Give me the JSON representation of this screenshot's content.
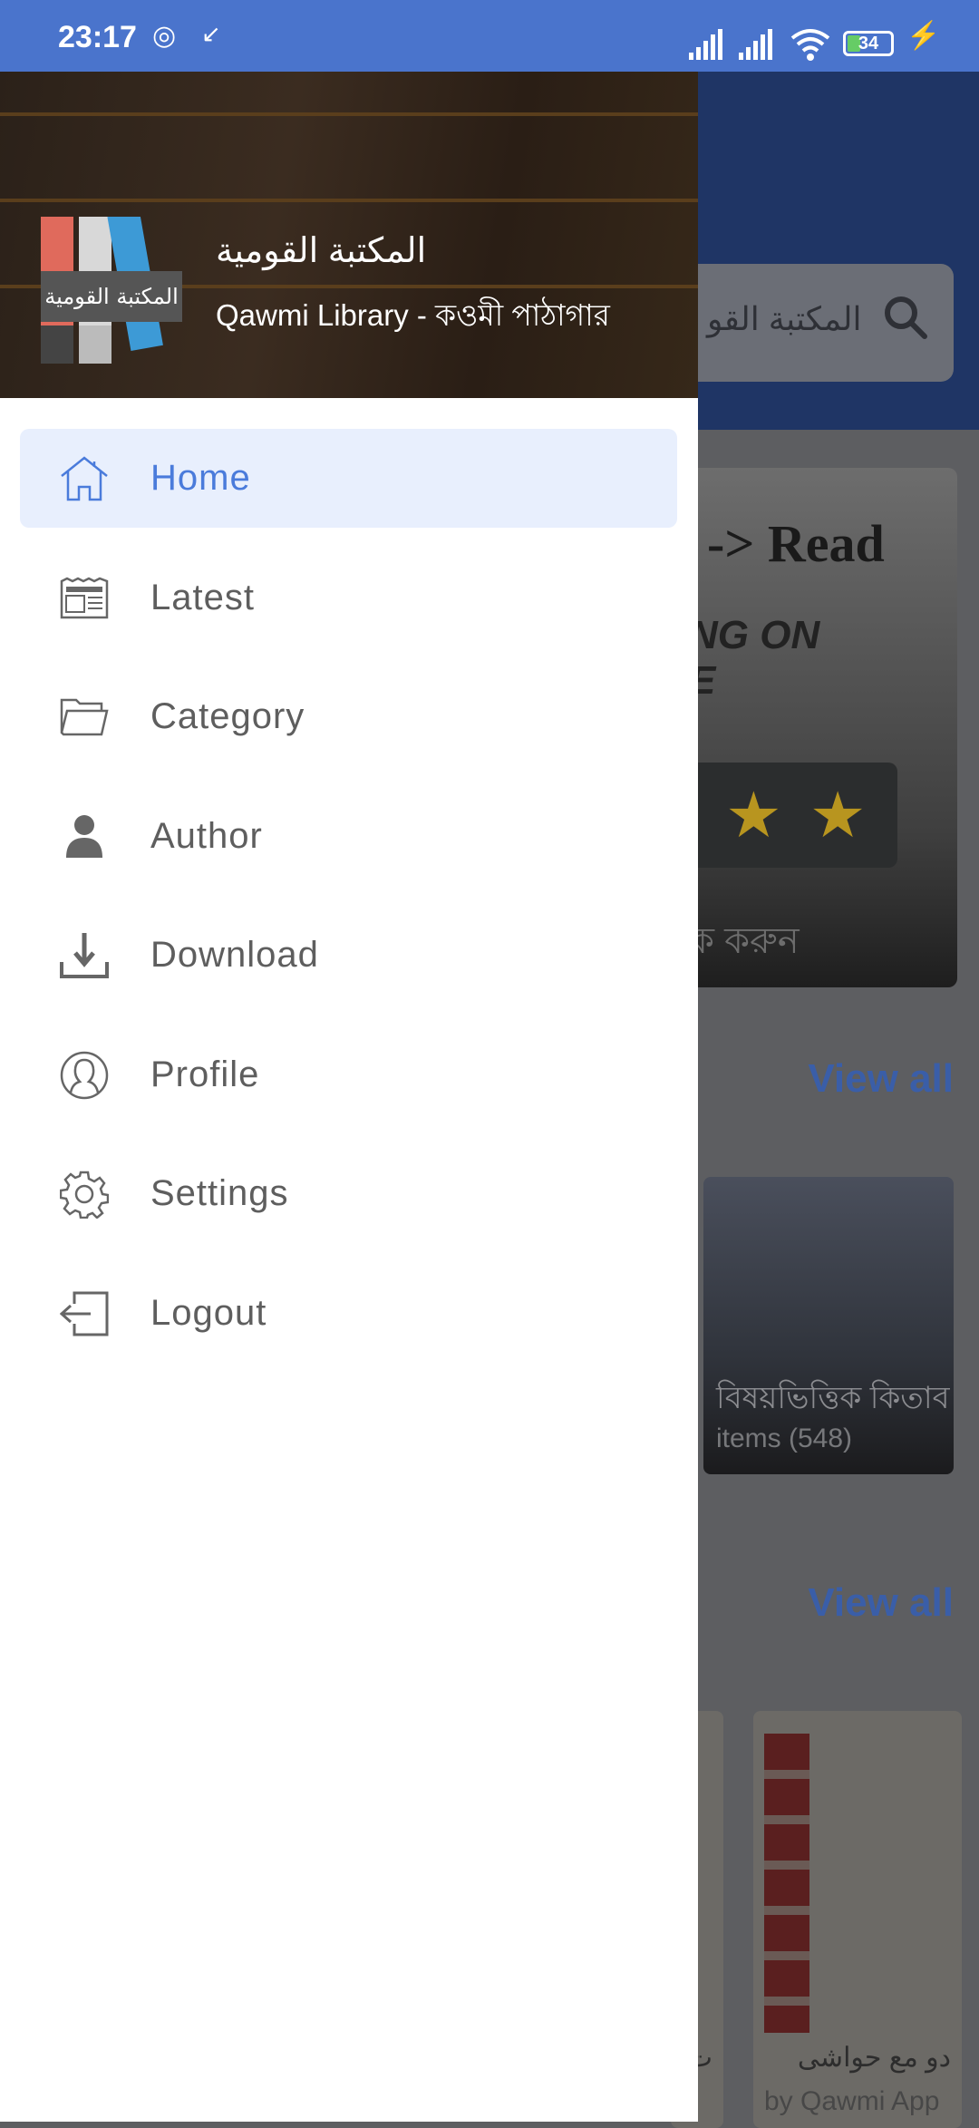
{
  "status_bar": {
    "time": "23:17",
    "battery": "34"
  },
  "drawer": {
    "header": {
      "title_arabic": "المكتبة القومية",
      "subtitle": "Qawmi Library - কওমী পাঠাগার",
      "logo_text": "المكتبة القومية"
    },
    "items": [
      {
        "label": "Home",
        "icon": "home-icon",
        "active": true
      },
      {
        "label": "Latest",
        "icon": "newspaper-icon"
      },
      {
        "label": "Category",
        "icon": "folder-icon"
      },
      {
        "label": "Author",
        "icon": "person-icon"
      },
      {
        "label": "Download",
        "icon": "download-icon"
      },
      {
        "label": "Profile",
        "icon": "profile-icon"
      },
      {
        "label": "Settings",
        "icon": "gear-icon"
      },
      {
        "label": "Logout",
        "icon": "logout-icon"
      }
    ]
  },
  "background": {
    "search_placeholder": "المكتبة القو",
    "banner": {
      "line1": "-> Read",
      "line2": "NG ON",
      "line3": "E",
      "line4": "ক করুন",
      "stars": "★★"
    },
    "view_all_1": "View all",
    "category_card": {
      "name": "বিষয়ভিত্তিক কিতাব",
      "count": "items (548)"
    },
    "view_all_2": "View all",
    "book_card": {
      "name": "دو مع حواشی",
      "by": "by Qawmi App"
    },
    "book_card_left": {
      "name": "ت",
      "by": "."
    }
  },
  "colors": {
    "accent": "#4a7bdb",
    "status_bar": "#4a74cc",
    "active_bg": "#e8effd"
  }
}
